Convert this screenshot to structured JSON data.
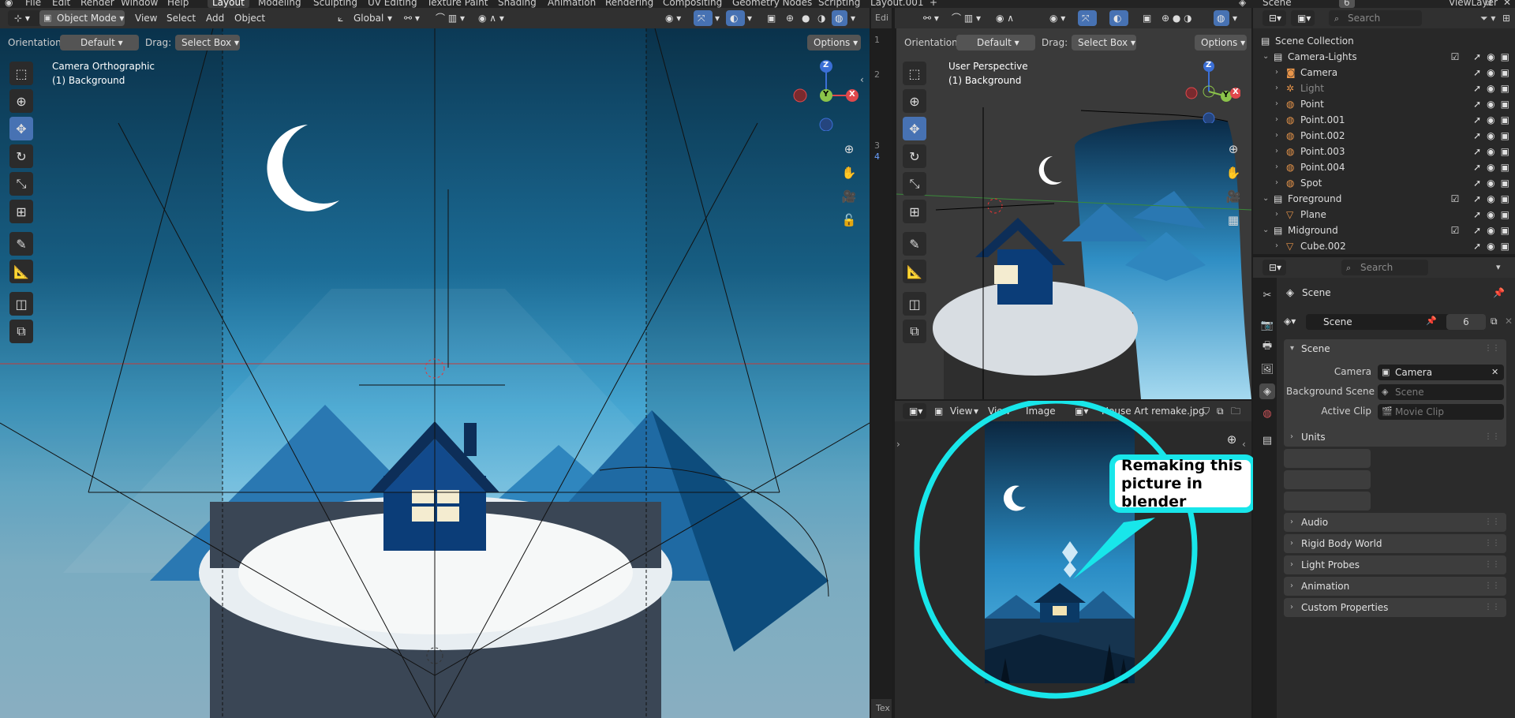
{
  "topbar": {
    "menus": [
      "File",
      "Edit",
      "Render",
      "Window",
      "Help"
    ],
    "workspaces": [
      "Layout",
      "Modeling",
      "Sculpting",
      "UV Editing",
      "Texture Paint",
      "Shading",
      "Animation",
      "Rendering",
      "Compositing",
      "Geometry Nodes",
      "Scripting",
      "Layout.001"
    ],
    "active_workspace": "Layout",
    "add_tab": "+",
    "scene_name": "Scene",
    "scene_users": "6",
    "view_layer": "ViewLayer"
  },
  "viewport_left": {
    "mode": "Object Mode",
    "menus": [
      "View",
      "Select",
      "Add",
      "Object"
    ],
    "transform_orientation": "Global",
    "orientation_label": "Orientation:",
    "orientation_value": "Default",
    "drag_label": "Drag:",
    "drag_value": "Select Box",
    "options": "Options",
    "view_name": "Camera Orthographic",
    "collection_info": "(1) Background",
    "gizmo_axes": [
      "Z",
      "Y",
      "X"
    ]
  },
  "text_editor": {
    "header": "Edi",
    "line_numbers": [
      "1",
      "2",
      "3",
      "4"
    ],
    "footer": "Tex"
  },
  "viewport_right": {
    "orientation_label": "Orientation:",
    "orientation_value": "Default",
    "drag_label": "Drag:",
    "drag_value": "Select Box",
    "options": "Options",
    "view_name": "User Perspective",
    "collection_info": "(1) Background",
    "gizmo_axes": [
      "Z",
      "Y",
      "X"
    ]
  },
  "image_editor": {
    "menus": [
      "View",
      "View",
      "Image"
    ],
    "image_name": "House Art remake.jpg"
  },
  "annotation": {
    "bubble_text": "Remaking this picture in blender",
    "color": "#18e6ea"
  },
  "outliner": {
    "search_placeholder": "Search",
    "rows": [
      {
        "label": "Scene Collection",
        "depth": 0,
        "icon": "collection"
      },
      {
        "label": "Camera-Lights",
        "depth": 1,
        "icon": "collection",
        "checked": true
      },
      {
        "label": "Camera",
        "depth": 2,
        "icon": "camera"
      },
      {
        "label": "Light",
        "depth": 2,
        "icon": "light",
        "dim": true
      },
      {
        "label": "Point",
        "depth": 2,
        "icon": "point-light"
      },
      {
        "label": "Point.001",
        "depth": 2,
        "icon": "point-light"
      },
      {
        "label": "Point.002",
        "depth": 2,
        "icon": "point-light"
      },
      {
        "label": "Point.003",
        "depth": 2,
        "icon": "point-light"
      },
      {
        "label": "Point.004",
        "depth": 2,
        "icon": "point-light"
      },
      {
        "label": "Spot",
        "depth": 2,
        "icon": "spot-light"
      },
      {
        "label": "Foreground",
        "depth": 1,
        "icon": "collection",
        "checked": true
      },
      {
        "label": "Plane",
        "depth": 2,
        "icon": "mesh"
      },
      {
        "label": "Midground",
        "depth": 1,
        "icon": "collection",
        "checked": true
      },
      {
        "label": "Cube.002",
        "depth": 2,
        "icon": "mesh"
      }
    ]
  },
  "properties": {
    "search_placeholder": "Search",
    "context_title": "Scene",
    "scene_field": "Scene",
    "scene_users": "6",
    "section_scene": "Scene",
    "camera_label": "Camera",
    "camera_value": "Camera",
    "background_scene_label": "Background Scene",
    "background_scene_value": "Scene",
    "active_clip_label": "Active Clip",
    "active_clip_value": "Movie Clip",
    "panels": [
      "Units",
      "Audio",
      "Rigid Body World",
      "Light Probes",
      "Animation",
      "Custom Properties"
    ]
  }
}
